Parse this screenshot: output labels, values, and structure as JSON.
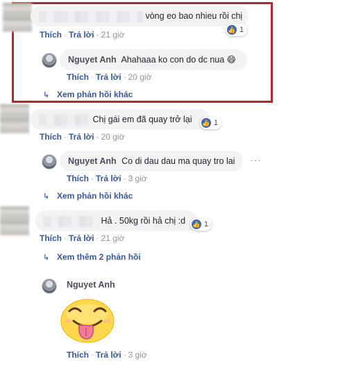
{
  "actions": {
    "like": "Thích",
    "reply": "Trả lời",
    "sep": "·"
  },
  "reaction_glyph": "👍",
  "comments": [
    {
      "text": "vòng eo bao nhieu rồi chị",
      "time": "21 giờ",
      "reaction_count": "1",
      "reply": {
        "author": "Nguyet Anh",
        "text": "Ahahaaa ko con do dc nua",
        "emoji": "😄",
        "time": "20 giờ"
      },
      "more_replies": "Xem phản hồi khác"
    },
    {
      "text": "Chị gái em đã quay trở lại",
      "time": "20 giờ",
      "reaction_count": "1",
      "reply": {
        "author": "Nguyet Anh",
        "text": "Co di dau dau ma quay tro lai",
        "time": "3 giờ"
      },
      "more_replies": "Xem phản hồi khác"
    },
    {
      "text": "Hả . 50kg rồi hả chị :d",
      "time": "21 giờ",
      "reaction_count": "1",
      "more_replies": "Xem thêm 2 phản hồi"
    }
  ],
  "last_reply": {
    "author": "Nguyet Anh",
    "sticker": "tongue-out-face-sticker",
    "time": "3 giờ"
  },
  "colors": {
    "link": "#385898",
    "highlight": "#b3262a",
    "bubble": "#f2f3f5",
    "like_badge": "#4267b2"
  }
}
